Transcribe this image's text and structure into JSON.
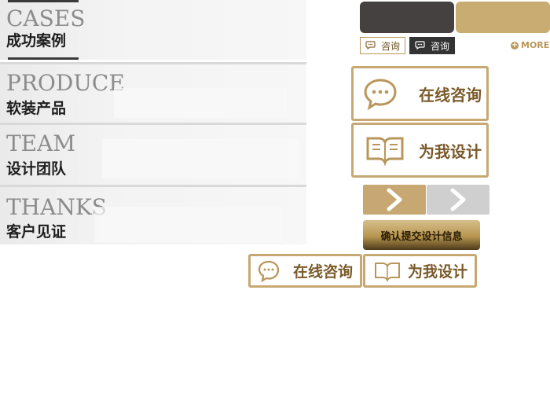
{
  "sections": [
    {
      "en": "CASES",
      "cn": "成功案例"
    },
    {
      "en": "PRODUCE",
      "cn": "软装产品"
    },
    {
      "en": "TEAM",
      "cn": "设计团队"
    },
    {
      "en": "THANKS",
      "cn": "客户见证"
    }
  ],
  "consult_small": {
    "light_label": "咨询",
    "dark_label": "咨询"
  },
  "more": {
    "label": "MORE"
  },
  "big_buttons": {
    "online_consult": "在线咨询",
    "design_for_me": "为我设计"
  },
  "confirm": {
    "label": "确认提交设计信息"
  },
  "bottom_buttons": {
    "online_consult": "在线咨询",
    "design_for_me": "为我设计"
  },
  "colors": {
    "gold": "#c7a873",
    "dark": "#444140",
    "gold_text": "#7a5a2a"
  }
}
